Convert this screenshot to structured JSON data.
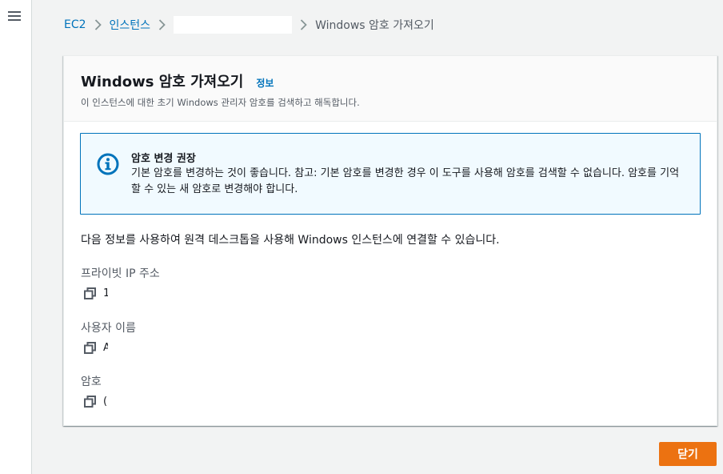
{
  "breadcrumb": {
    "ec2": "EC2",
    "instances": "인스턴스",
    "current": "Windows 암호 가져오기"
  },
  "panel": {
    "title": "Windows 암호 가져오기",
    "info_link": "정보",
    "description": "이 인스턴스에 대한 초기 Windows 관리자 암호를 검색하고 해독합니다."
  },
  "alert": {
    "icon": "info-icon",
    "title": "암호 변경 권장",
    "body": "기본 암호를 변경하는 것이 좋습니다. 참고: 기본 암호를 변경한 경우 이 도구를 사용해 암호를 검색할 수 없습니다. 암호를 기억할 수 있는 새 암호로 변경해야 합니다."
  },
  "intro_text": "다음 정보를 사용하여 원격 데스크톱을 사용해 Windows 인스턴스에 연결할 수 있습니다.",
  "fields": [
    {
      "label": "프라이빗 IP 주소",
      "value": "1",
      "icon": "copy-icon"
    },
    {
      "label": "사용자 이름",
      "value": "A",
      "icon": "copy-icon"
    },
    {
      "label": "암호",
      "value": "(",
      "icon": "copy-icon"
    }
  ],
  "close_button": "닫기",
  "colors": {
    "link": "#0073bb",
    "primary_button": "#ec7211",
    "alert_bg": "#f1faff",
    "alert_border": "#0073bb"
  }
}
